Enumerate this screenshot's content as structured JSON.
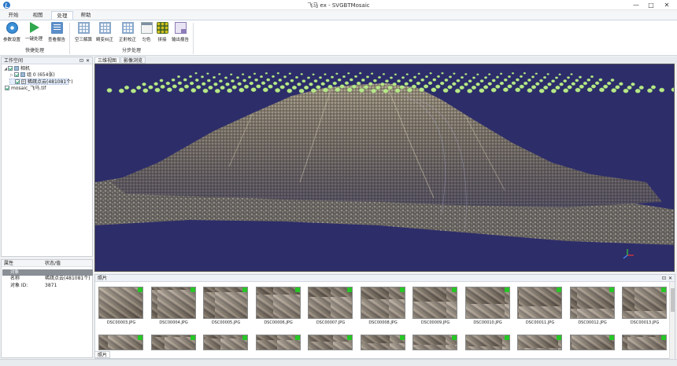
{
  "window": {
    "title": "飞马 ex - SVGBTMosaic",
    "minimize": "—",
    "maximize": "□",
    "close": "✕"
  },
  "ribbon_tabs": [
    {
      "label": "开始"
    },
    {
      "label": "视图"
    },
    {
      "label": "处理",
      "active": true
    },
    {
      "label": "帮助"
    }
  ],
  "ribbon": {
    "quick_group": {
      "label": "快捷处理",
      "buttons": [
        {
          "label": "参数设置",
          "icon": "gear-icon"
        },
        {
          "label": "一键处理",
          "icon": "play-icon"
        },
        {
          "label": "查看报告",
          "icon": "report-icon"
        }
      ]
    },
    "step_group": {
      "label": "分步处理",
      "buttons": [
        {
          "label": "空三解算",
          "icon": "grid-icon"
        },
        {
          "label": "畸变纠正",
          "icon": "grid-icon"
        },
        {
          "label": "正射校正",
          "icon": "grid-icon"
        },
        {
          "label": "匀色",
          "icon": "calendar-icon"
        },
        {
          "label": "拼接",
          "icon": "mosaic-dots-icon"
        },
        {
          "label": "输出报告",
          "icon": "document-icon"
        }
      ]
    }
  },
  "workspace": {
    "title": "工作空间",
    "tree": [
      {
        "label": "相机",
        "level": 0,
        "expanded": true
      },
      {
        "label": "组 0 (654张)",
        "level": 1,
        "expanded": false
      },
      {
        "label": "稀疏点云(481081个)",
        "level": 1,
        "selected": true
      },
      {
        "label": "mosaic_飞马.tif",
        "level": 0
      }
    ]
  },
  "properties": {
    "col_attr": "属性",
    "col_value": "状态/值",
    "section": "对象",
    "rows": [
      {
        "key": "名称",
        "value": "稀疏点云(481081个)"
      },
      {
        "key": "对象 ID:",
        "value": "3871"
      }
    ]
  },
  "view_tabs": [
    {
      "label": "三维视图",
      "active": true
    },
    {
      "label": "影像浏览"
    }
  ],
  "photos": {
    "title": "照片",
    "tab": "照片",
    "row1": [
      "DSC00003.JPG",
      "DSC00004.JPG",
      "DSC00005.JPG",
      "DSC00006.JPG",
      "DSC00007.JPG",
      "DSC00008.JPG",
      "DSC00009.JPG",
      "DSC00010.JPG",
      "DSC00011.JPG",
      "DSC00012.JPG",
      "DSC00013.JPG"
    ]
  },
  "colors": {
    "viewport_bg": "#2d2d6a",
    "camera_dot": "#b8e888",
    "tag_green": "#26c626"
  }
}
